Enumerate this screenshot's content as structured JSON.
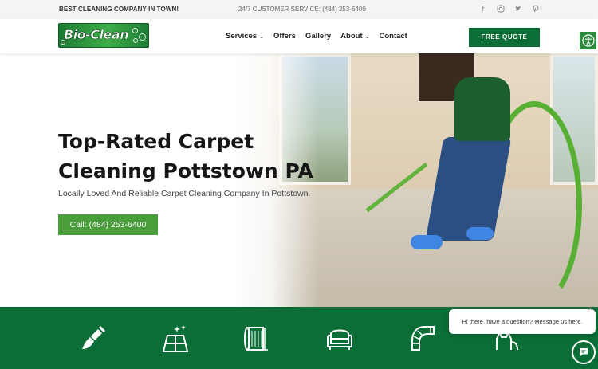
{
  "topbar": {
    "tagline": "BEST CLEANING COMPANY IN TOWN!",
    "service": "24/7 CUSTOMER SERVICE: (484) 253-6400",
    "socials": [
      "facebook-icon",
      "instagram-icon",
      "twitter-icon",
      "pinterest-icon"
    ]
  },
  "header": {
    "logo_text": "Bio-Clean",
    "nav": [
      {
        "label": "Services",
        "has_dropdown": true
      },
      {
        "label": "Offers",
        "has_dropdown": false
      },
      {
        "label": "Gallery",
        "has_dropdown": false
      },
      {
        "label": "About",
        "has_dropdown": true
      },
      {
        "label": "Contact",
        "has_dropdown": false
      }
    ],
    "quote_label": "FREE QUOTE"
  },
  "hero": {
    "title_line1": "Top-Rated Carpet",
    "title_line2": "Cleaning Pottstown PA",
    "subtitle": "Locally Loved And Reliable Carpet Cleaning Company In Pottstown.",
    "call_label": "Call: (484) 253-6400"
  },
  "services_band": {
    "icons": [
      "brush-icon",
      "tile-floor-icon",
      "rug-icon",
      "armchair-icon",
      "air-duct-icon",
      "pet-icon"
    ]
  },
  "chat": {
    "message": "Hi there, have a question? Message us here."
  },
  "colors": {
    "brand_green": "#0b6e36",
    "call_green": "#4a9d3b",
    "hose_green": "#57b034"
  }
}
